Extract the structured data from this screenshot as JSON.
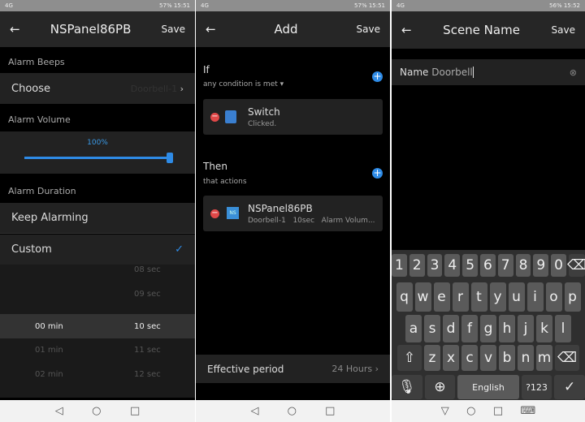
{
  "panels": [
    {
      "status": {
        "left": "4G",
        "right": "57% 15:51"
      },
      "header": {
        "title": "NSPanel86PB",
        "save": "Save"
      },
      "alarm_beeps": "Alarm Beeps",
      "choose": {
        "label": "Choose",
        "value": "Doorbell-1"
      },
      "alarm_volume": "Alarm Volume",
      "volume": {
        "label": "100%",
        "value": 100
      },
      "alarm_duration": "Alarm Duration",
      "keep_alarming": "Keep Alarming",
      "custom": "Custom",
      "picker": {
        "minutes": [
          "",
          "",
          "00 min",
          "01 min",
          "02 min"
        ],
        "seconds": [
          "08 sec",
          "09 sec",
          "10 sec",
          "11 sec",
          "12 sec"
        ]
      }
    },
    {
      "status": {
        "left": "4G",
        "right": "57% 15:51"
      },
      "header": {
        "title": "Add",
        "save": "Save"
      },
      "if": {
        "title": "If",
        "subtitle": "any condition is met"
      },
      "condition": {
        "name": "Switch",
        "detail": "Clicked.",
        "icon_text": ""
      },
      "then": {
        "title": "Then",
        "subtitle": "that actions"
      },
      "action": {
        "name": "NSPanel86PB",
        "detail": "Doorbell-1   10sec   Alarm Volum...",
        "icon_text": "NS"
      },
      "effective": {
        "label": "Effective period",
        "value": "24 Hours"
      }
    },
    {
      "status": {
        "left": "4G",
        "right": "56% 15:52"
      },
      "header": {
        "title": "Scene Name",
        "save": "Save"
      },
      "name": {
        "label": "Name",
        "value": "Doorbell"
      },
      "keyboard": {
        "row1": [
          "1",
          "2",
          "3",
          "4",
          "5",
          "6",
          "7",
          "8",
          "9",
          "0"
        ],
        "row2": [
          "q",
          "w",
          "e",
          "r",
          "t",
          "y",
          "u",
          "i",
          "o",
          "p"
        ],
        "row3": [
          "a",
          "s",
          "d",
          "f",
          "g",
          "h",
          "j",
          "k",
          "l"
        ],
        "row4": [
          "z",
          "x",
          "c",
          "v",
          "b",
          "n",
          "m"
        ],
        "space": "English",
        "sym": "?123"
      }
    }
  ],
  "colors": {
    "accent": "#2e8be6",
    "danger": "#e04848"
  }
}
